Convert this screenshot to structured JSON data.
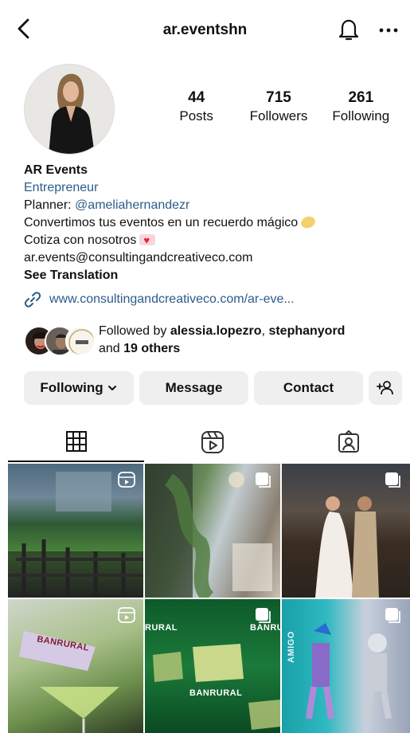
{
  "header": {
    "username": "ar.eventshn",
    "back_icon": "chevron-left-icon",
    "bell_icon": "bell-icon",
    "more_icon": "more-horizontal-icon"
  },
  "stats": [
    {
      "num": "44",
      "label": "Posts"
    },
    {
      "num": "715",
      "label": "Followers"
    },
    {
      "num": "261",
      "label": "Following"
    }
  ],
  "bio": {
    "name": "AR Events",
    "category": "Entrepreneur",
    "planner_prefix": "Planner: ",
    "planner_mention": "@ameliahernandezr",
    "line1": "Convertimos tus eventos en un recuerdo mágico",
    "line2": "Cotiza con nosotros",
    "email": "ar.events@consultingandcreativeco.com",
    "see_translation": "See Translation"
  },
  "link": {
    "url": "www.consultingandcreativeco.com/ar-eve...",
    "icon": "link-icon"
  },
  "followed_by": {
    "prefix": "Followed by ",
    "user1": "alessia.lopezro",
    "sep": ", ",
    "user2": "stephanyord",
    "and": "and ",
    "others": "19 others"
  },
  "buttons": {
    "following": "Following",
    "message": "Message",
    "contact": "Contact",
    "add_person_icon": "add-person-icon"
  },
  "tabs": [
    {
      "name": "posts",
      "icon": "grid-icon",
      "active": true
    },
    {
      "name": "reels",
      "icon": "reels-icon",
      "active": false
    },
    {
      "name": "tagged",
      "icon": "tagged-person-icon",
      "active": false
    }
  ],
  "grid": {
    "cell4_text": "BANRURAL",
    "cell5_text": "BANRURAL",
    "cell5_text2": "RURAL",
    "cell6_text": "AMIGO"
  },
  "colors": {
    "link_blue": "#2b5c8a",
    "button_bg": "#efefef"
  }
}
